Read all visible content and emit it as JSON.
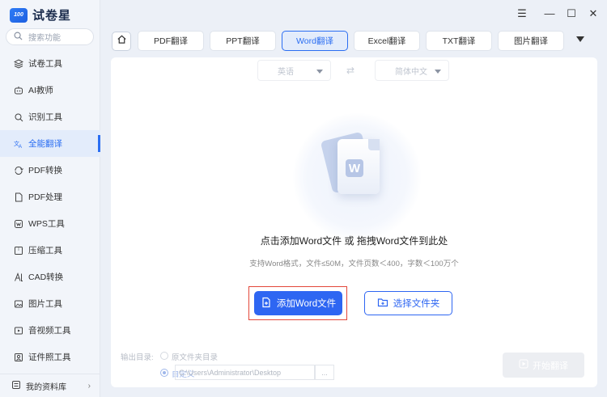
{
  "app": {
    "logo_badge": "100",
    "name": "试卷星"
  },
  "search": {
    "placeholder": "搜索功能"
  },
  "sidebar": {
    "items": [
      {
        "label": "试卷工具",
        "icon": "layers-icon"
      },
      {
        "label": "AI教师",
        "icon": "ai-bot-icon"
      },
      {
        "label": "识别工具",
        "icon": "scan-icon"
      },
      {
        "label": "全能翻译",
        "icon": "translate-icon",
        "active": true
      },
      {
        "label": "PDF转换",
        "icon": "convert-icon"
      },
      {
        "label": "PDF处理",
        "icon": "document-icon"
      },
      {
        "label": "WPS工具",
        "icon": "wps-icon"
      },
      {
        "label": "压缩工具",
        "icon": "compress-icon"
      },
      {
        "label": "CAD转换",
        "icon": "cad-icon"
      },
      {
        "label": "图片工具",
        "icon": "image-icon"
      },
      {
        "label": "音视频工具",
        "icon": "video-icon"
      },
      {
        "label": "证件照工具",
        "icon": "id-photo-icon"
      }
    ],
    "library_label": "我的资料库"
  },
  "window": {
    "menu": "☰",
    "minimize": "—",
    "maximize": "☐",
    "close": "✕"
  },
  "tabs": [
    {
      "label": "PDF翻译"
    },
    {
      "label": "PPT翻译"
    },
    {
      "label": "Word翻译",
      "active": true
    },
    {
      "label": "Excel翻译"
    },
    {
      "label": "TXT翻译"
    },
    {
      "label": "图片翻译"
    }
  ],
  "translate": {
    "source_lang": "英语",
    "target_lang": "简体中文"
  },
  "dropzone": {
    "icon_letter": "W",
    "main_text": "点击添加Word文件 或 拖拽Word文件到此处",
    "hint_text": "支持Word格式，文件≤50M，文件页数＜400，字数＜100万个"
  },
  "buttons": {
    "add_file": "添加Word文件",
    "choose_folder": "选择文件夹",
    "start": "开始翻译"
  },
  "output": {
    "label": "输出目录:",
    "option_source": "原文件夹目录",
    "option_custom": "自定义",
    "path": "C:\\Users\\Administrator\\Desktop",
    "browse": "..."
  },
  "colors": {
    "accent": "#2e66f2",
    "active_bg": "#e3ecfb",
    "highlight_border": "#e3473a"
  }
}
